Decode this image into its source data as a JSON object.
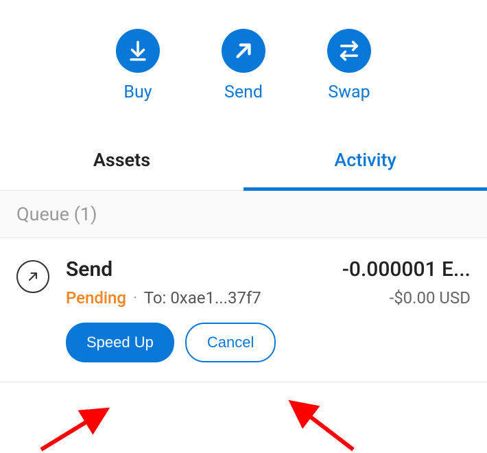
{
  "actions": {
    "buy": {
      "label": "Buy"
    },
    "send": {
      "label": "Send"
    },
    "swap": {
      "label": "Swap"
    }
  },
  "tabs": {
    "assets": {
      "label": "Assets"
    },
    "activity": {
      "label": "Activity"
    }
  },
  "queue": {
    "header": "Queue (1)"
  },
  "tx": {
    "title": "Send",
    "amount": "-0.000001 E...",
    "status": "Pending",
    "separator": "·",
    "to_label": "To: 0xae1...37f7",
    "fiat": "-$0.00 USD",
    "speed_up_label": "Speed Up",
    "cancel_label": "Cancel"
  }
}
